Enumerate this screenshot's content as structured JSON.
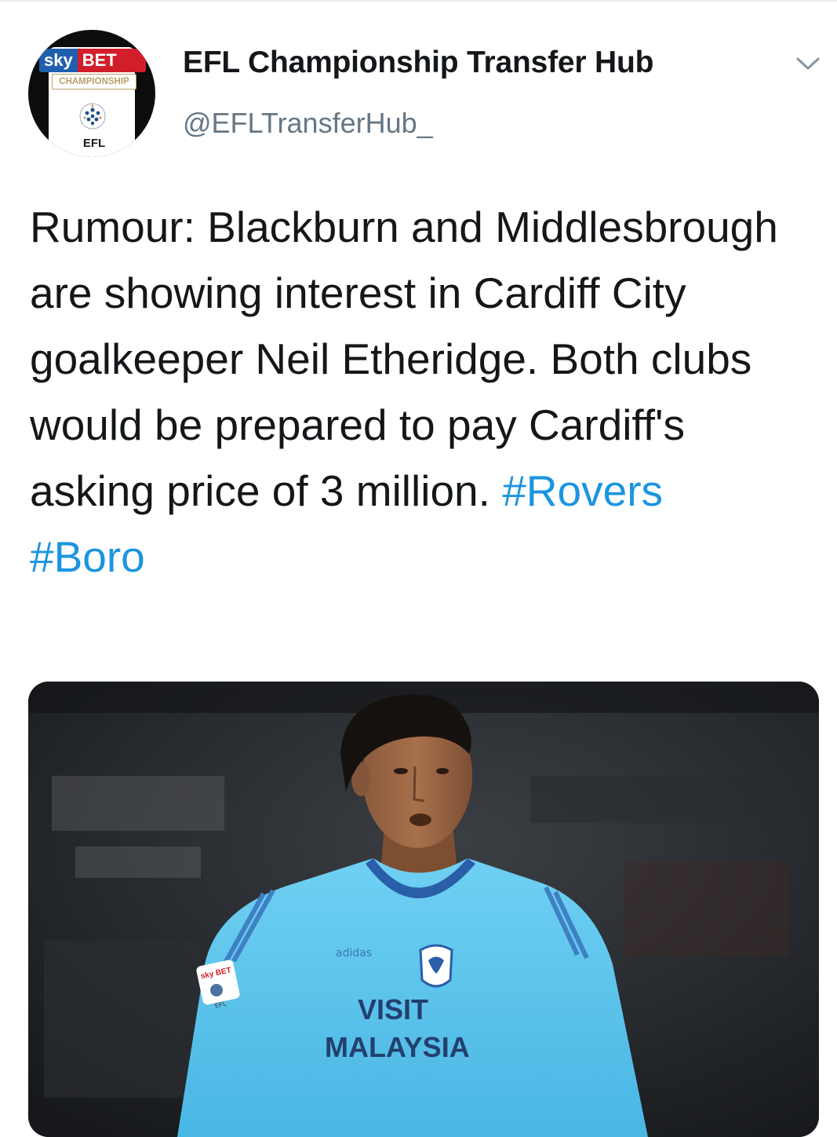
{
  "account": {
    "display_name": "EFL Championship Transfer Hub",
    "handle": "@EFLTransferHub_",
    "avatar": {
      "sky": "sky",
      "bet": "BET",
      "competition": "CHAMPIONSHIP",
      "league": "EFL"
    }
  },
  "menu_icon": "chevron-down-icon",
  "tweet": {
    "text": "Rumour: Blackburn and Middlesbrough are showing interest in Cardiff City goalkeeper Neil Etheridge. Both clubs would be prepared to pay Cardiff's asking price of 3 million.",
    "hashtags": [
      "#Rovers",
      "#Boro"
    ]
  },
  "media": {
    "shirt_sponsor_line1": "VISIT",
    "shirt_sponsor_line2": "MALAYSIA",
    "kit_maker": "adidas",
    "sleeve_badge": "sky BET",
    "sleeve_badge_lower": "EFL"
  },
  "colors": {
    "hashtag": "#1b95e0",
    "text": "#14171a",
    "secondary": "#657786",
    "jersey": "#5bc4ec"
  }
}
